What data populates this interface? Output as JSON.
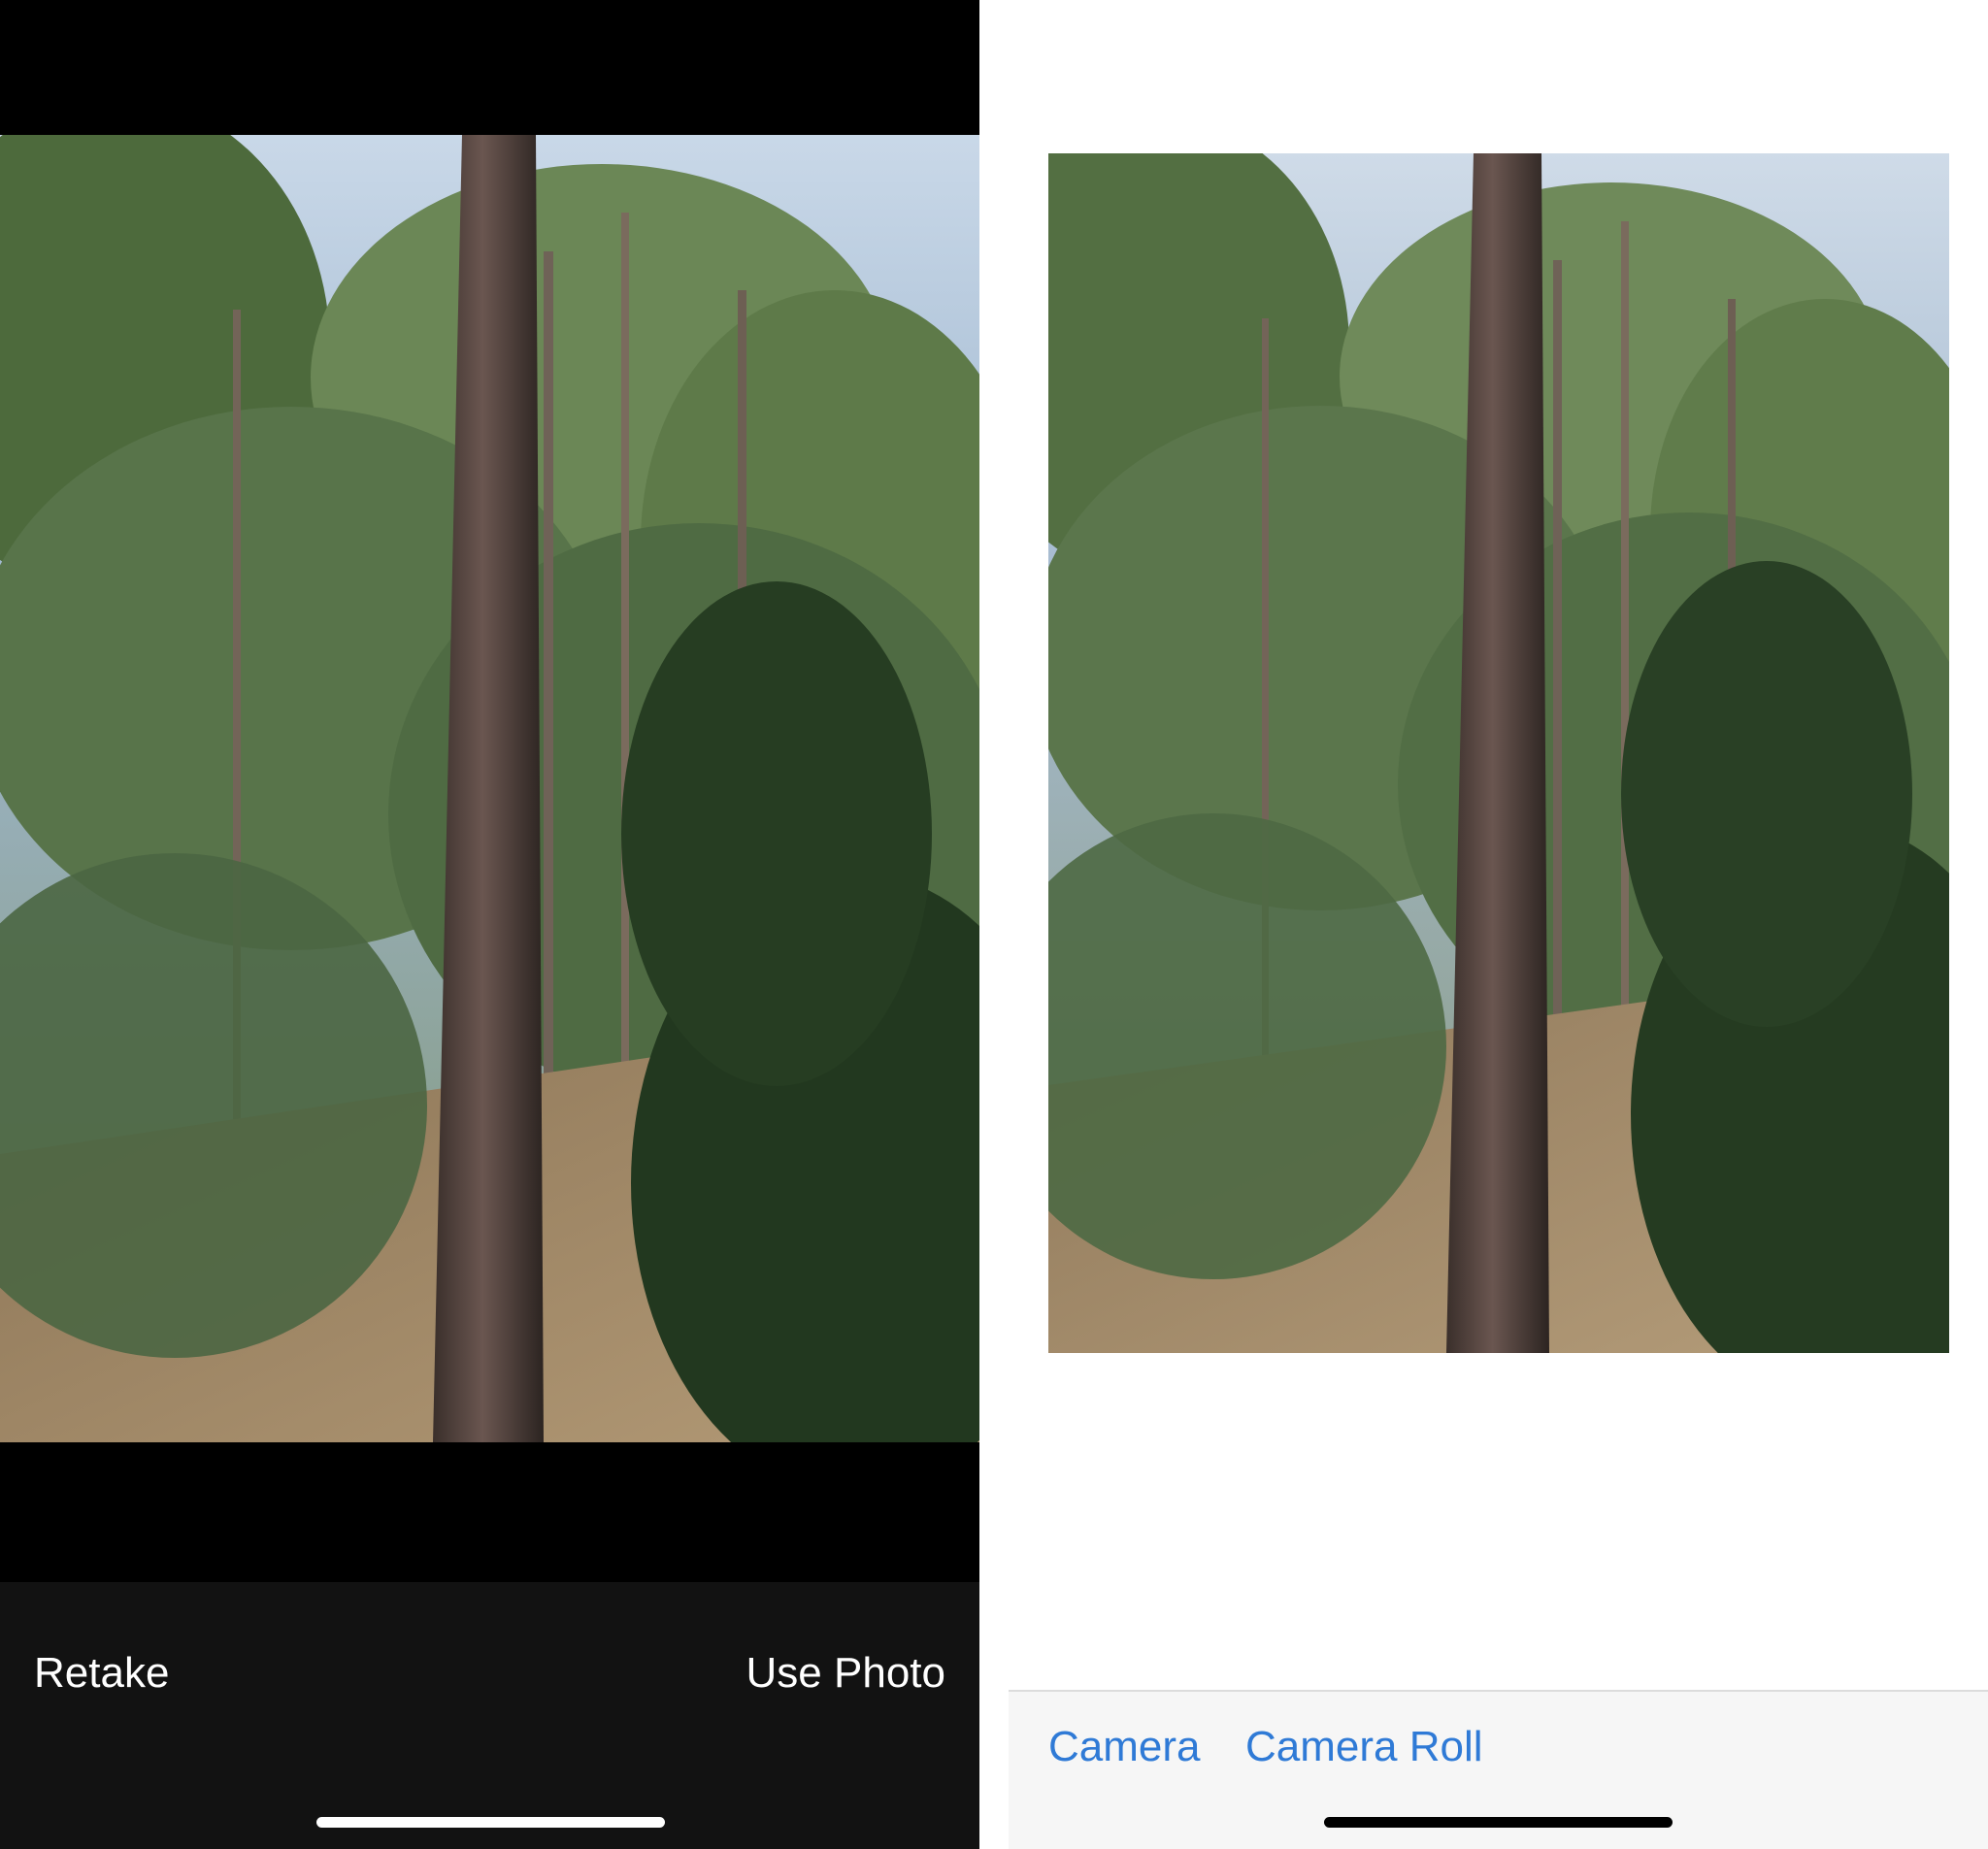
{
  "left_screen": {
    "retake_label": "Retake",
    "use_photo_label": "Use Photo"
  },
  "right_screen": {
    "camera_label": "Camera",
    "camera_roll_label": "Camera Roll"
  },
  "colors": {
    "left_background": "#000000",
    "left_toolbar": "#121212",
    "left_toolbar_text": "#ffffff",
    "right_background": "#ffffff",
    "right_toolbar": "#f6f6f6",
    "accent_link": "#2f7ad6"
  },
  "photo": {
    "subject": "forest with tall pine trunk"
  }
}
